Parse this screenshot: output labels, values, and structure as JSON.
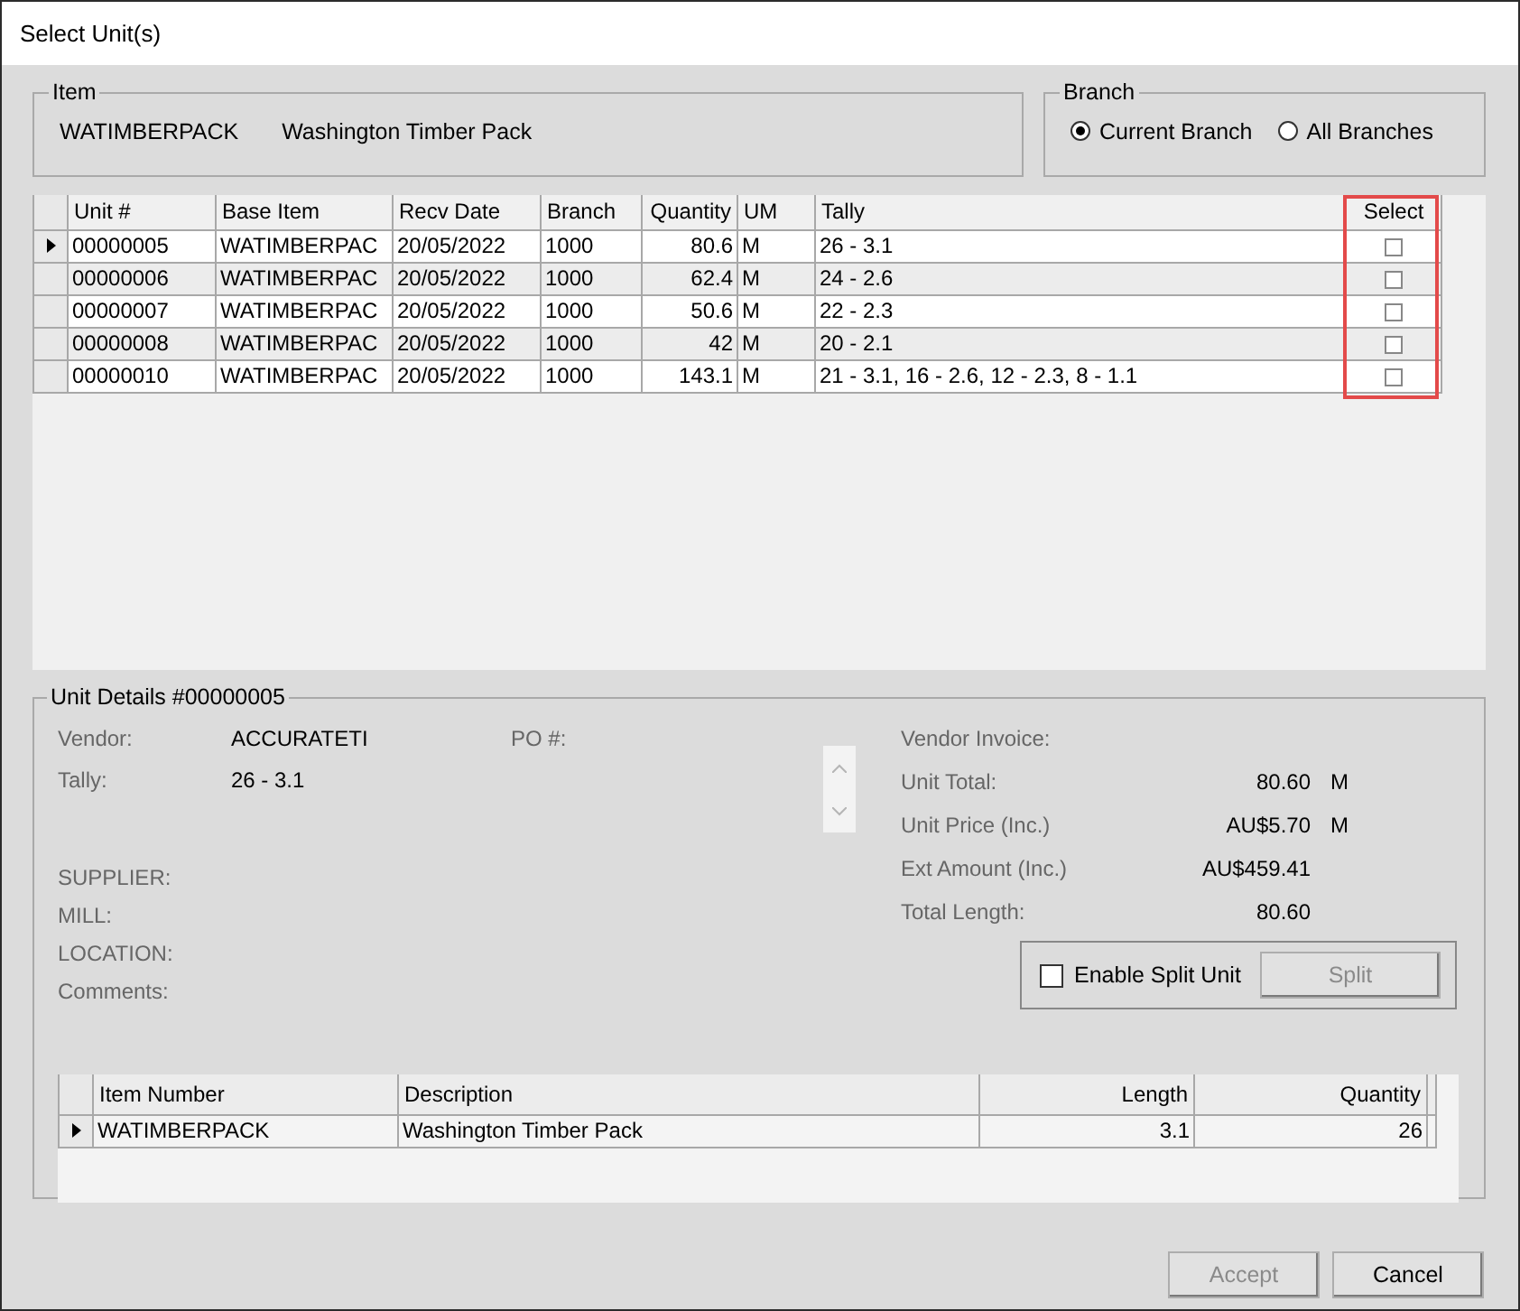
{
  "window": {
    "title": "Select Unit(s)"
  },
  "item": {
    "legend": "Item",
    "code": "WATIMBERPACK",
    "description": "Washington Timber Pack"
  },
  "branch": {
    "legend": "Branch",
    "options": [
      {
        "label": "Current Branch",
        "selected": true
      },
      {
        "label": "All Branches",
        "selected": false
      }
    ]
  },
  "units": {
    "columns": [
      {
        "label": "Unit #",
        "kind": "text"
      },
      {
        "label": "Base Item",
        "kind": "text"
      },
      {
        "label": "Recv Date",
        "kind": "text"
      },
      {
        "label": "Branch",
        "kind": "text"
      },
      {
        "label": "Quantity",
        "kind": "number"
      },
      {
        "label": "UM",
        "kind": "text"
      },
      {
        "label": "Tally",
        "kind": "text"
      },
      {
        "label": "Select",
        "kind": "check"
      }
    ],
    "select_highlighted": true,
    "rows": [
      {
        "cells": [
          "00000005",
          "WATIMBERPAC",
          "20/05/2022",
          "1000",
          "80.6",
          "M",
          "26 - 3.1"
        ],
        "checked": false,
        "current": true
      },
      {
        "cells": [
          "00000006",
          "WATIMBERPAC",
          "20/05/2022",
          "1000",
          "62.4",
          "M",
          "24 - 2.6"
        ],
        "checked": false,
        "current": false
      },
      {
        "cells": [
          "00000007",
          "WATIMBERPAC",
          "20/05/2022",
          "1000",
          "50.6",
          "M",
          "22 - 2.3"
        ],
        "checked": false,
        "current": false
      },
      {
        "cells": [
          "00000008",
          "WATIMBERPAC",
          "20/05/2022",
          "1000",
          "42",
          "M",
          "20 - 2.1"
        ],
        "checked": false,
        "current": false
      },
      {
        "cells": [
          "00000010",
          "WATIMBERPAC",
          "20/05/2022",
          "1000",
          "143.1",
          "M",
          "21 - 3.1, 16 - 2.6, 12 - 2.3, 8 - 1.1"
        ],
        "checked": false,
        "current": false
      }
    ]
  },
  "unit_details": {
    "legend": "Unit Details #00000005",
    "vendor": {
      "label": "Vendor:",
      "value": "ACCURATETI"
    },
    "po": {
      "label": "PO #:"
    },
    "tally": {
      "label": "Tally:",
      "value": "26 - 3.1"
    },
    "notes": [
      "SUPPLIER:",
      "MILL:",
      "LOCATION:",
      "Comments:"
    ],
    "totals": [
      {
        "label": "Vendor Invoice:"
      },
      {
        "label": "Unit Total:",
        "value": "80.60",
        "unit": "M"
      },
      {
        "label": "Unit Price (Inc.)",
        "value": "AU$5.70",
        "unit": "M"
      },
      {
        "label": "Ext Amount (Inc.)",
        "value": "AU$459.41"
      },
      {
        "label": "Total Length:",
        "value": "80.60"
      }
    ],
    "split": {
      "label": "Enable Split Unit",
      "checked": false,
      "button": "Split",
      "button_disabled": true
    },
    "lines": {
      "columns": [
        {
          "label": "Item Number",
          "kind": "text"
        },
        {
          "label": "Description",
          "kind": "text"
        },
        {
          "label": "Length",
          "kind": "number"
        },
        {
          "label": "Quantity",
          "kind": "number"
        }
      ],
      "rows": [
        {
          "cells": [
            "WATIMBERPACK",
            "Washington Timber Pack",
            "3.1",
            "26"
          ],
          "current": true
        }
      ]
    }
  },
  "buttons": [
    {
      "label": "Accept",
      "disabled": true
    },
    {
      "label": "Cancel",
      "disabled": false
    }
  ]
}
